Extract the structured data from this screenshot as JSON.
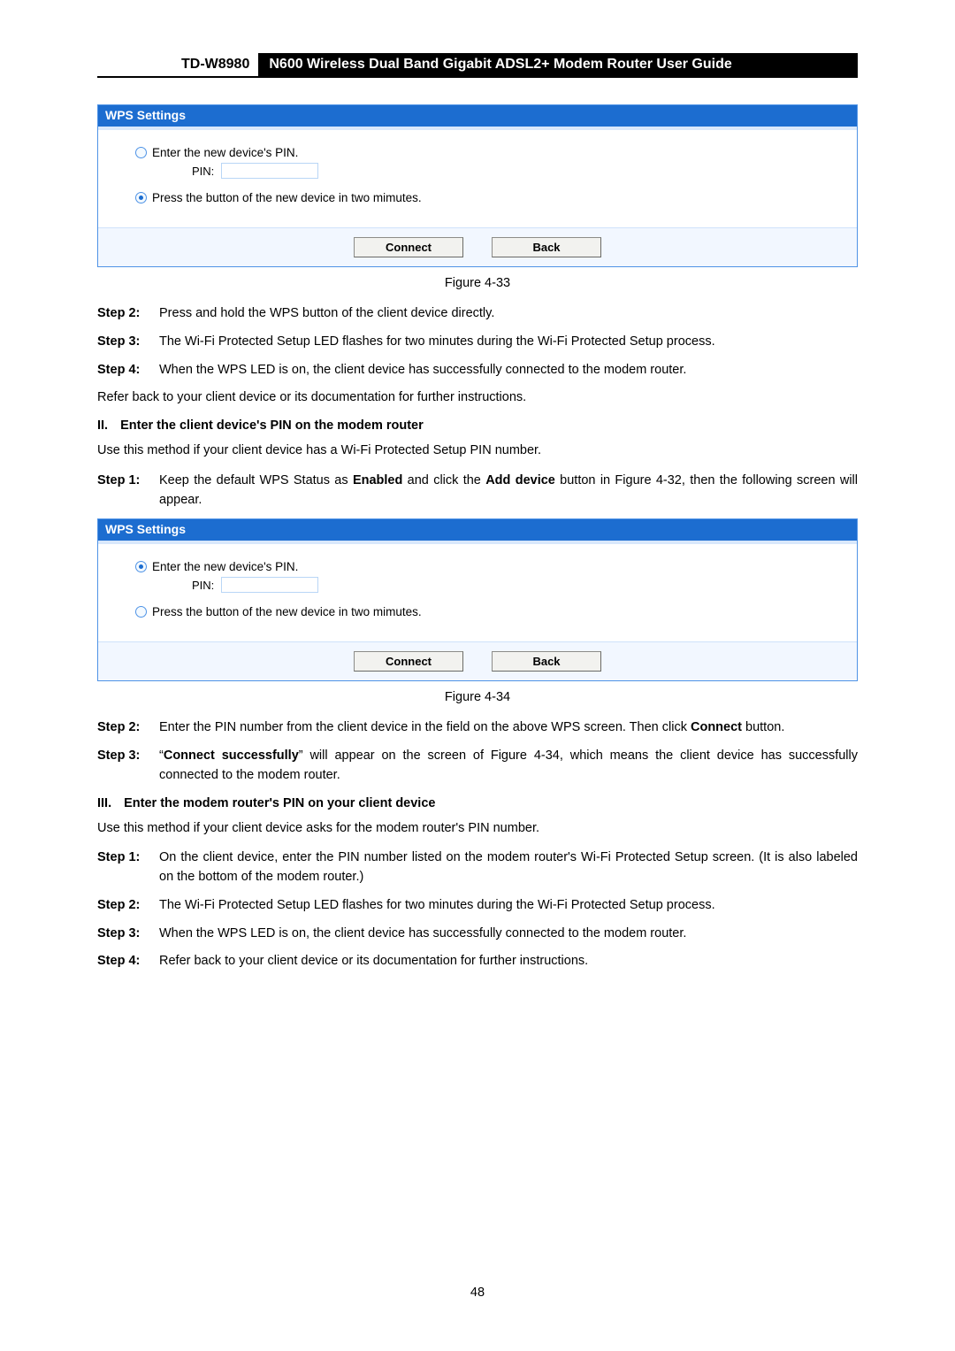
{
  "header": {
    "model": "TD-W8980",
    "title": "N600 Wireless Dual Band Gigabit ADSL2+ Modem Router User Guide"
  },
  "panel1": {
    "title": "WPS Settings",
    "radio_pin_label": "Enter the new device's PIN.",
    "pin_label": "PIN:",
    "pin_value": "",
    "radio_btn_label": "Press the button of the new device in two mimutes.",
    "connect": "Connect",
    "back": "Back",
    "caption": "Figure 4-33"
  },
  "stepsA": {
    "s2_lbl": "Step 2:",
    "s2_txt": "Press and hold the WPS button of the client device directly.",
    "s3_lbl": "Step 3:",
    "s3_txt": "The Wi-Fi Protected Setup LED flashes for two minutes during the Wi-Fi Protected Setup process.",
    "s4_lbl": "Step 4:",
    "s4_txt": "When the WPS LED is on, the client device has successfully connected to the modem router."
  },
  "refer_line": "Refer back to your client device or its documentation for further instructions.",
  "sectionII": {
    "num": "II.",
    "text": "Enter the client device's PIN on the modem router",
    "intro": "Use this method if your client device has a Wi-Fi Protected Setup PIN number.",
    "s1_lbl": "Step 1:",
    "s1_pre": "Keep the default WPS Status as ",
    "s1_enabled": "Enabled",
    "s1_mid": " and click the ",
    "s1_add": "Add device",
    "s1_post": " button in Figure 4-32, then the following screen will appear."
  },
  "panel2": {
    "title": "WPS Settings",
    "radio_pin_label": "Enter the new device's PIN.",
    "pin_label": "PIN:",
    "pin_value": "",
    "radio_btn_label": "Press the button of the new device in two mimutes.",
    "connect": "Connect",
    "back": "Back",
    "caption": "Figure 4-34"
  },
  "stepsB": {
    "s2_lbl": "Step 2:",
    "s2_pre": "Enter the PIN number from the client device in the field on the above WPS screen. Then click ",
    "s2_bold": "Connect",
    "s2_post": " button.",
    "s3_lbl": "Step 3:",
    "s3_q1": "“",
    "s3_bold": "Connect successfully",
    "s3_post": "” will appear on the screen of Figure 4-34, which means the client device has successfully connected to the modem router."
  },
  "sectionIII": {
    "num": "III.",
    "text": "Enter the modem router's PIN on your client device",
    "intro": "Use this method if your client device asks for the modem router's PIN number.",
    "s1_lbl": "Step 1:",
    "s1_txt": "On the client device, enter the PIN number listed on the modem router's Wi-Fi Protected Setup screen. (It is also labeled on the bottom of the modem router.)",
    "s2_lbl": "Step 2:",
    "s2_txt": "The Wi-Fi Protected Setup LED flashes for two minutes during the Wi-Fi Protected Setup process.",
    "s3_lbl": "Step 3:",
    "s3_txt": "When the WPS LED is on, the client device has successfully connected to the modem router.",
    "s4_lbl": "Step 4:",
    "s4_txt": "Refer back to your client device or its documentation for further instructions."
  },
  "page_number": "48"
}
